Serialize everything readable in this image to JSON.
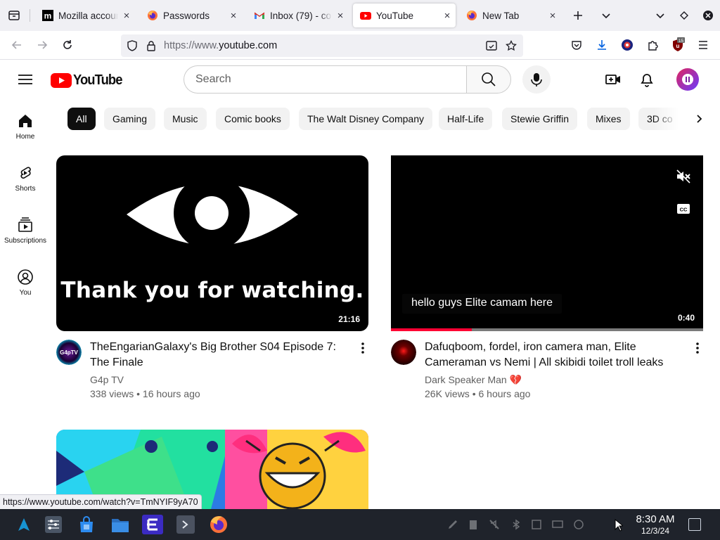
{
  "browser": {
    "tabs": [
      {
        "title": "Mozilla account",
        "favicon": "mozilla-m-icon",
        "active": false
      },
      {
        "title": "Passwords",
        "favicon": "firefox-icon",
        "active": false
      },
      {
        "title": "Inbox (79) - co",
        "favicon": "gmail-icon",
        "active": false
      },
      {
        "title": "YouTube",
        "favicon": "youtube-icon",
        "active": true
      },
      {
        "title": "New Tab",
        "favicon": "firefox-icon",
        "active": false
      }
    ],
    "tab_close_glyph": "×",
    "url_prefix": "https://www.",
    "url_domain": "youtube.com",
    "extension_badge": "15",
    "status_url": "https://www.youtube.com/watch?v=TmNYIF9yA70"
  },
  "youtube": {
    "logo_text": "YouTube",
    "search_placeholder": "Search",
    "guide": [
      {
        "label": "Home",
        "icon": "home-icon"
      },
      {
        "label": "Shorts",
        "icon": "shorts-icon"
      },
      {
        "label": "Subscriptions",
        "icon": "subscriptions-icon"
      },
      {
        "label": "You",
        "icon": "you-icon"
      }
    ],
    "chips": [
      "All",
      "Gaming",
      "Music",
      "Comic books",
      "The Walt Disney Company",
      "Half-Life",
      "Stewie Griffin",
      "Mixes",
      "3D co"
    ],
    "active_chip": "All",
    "videos": [
      {
        "thumb_text": "Thank you for watching.",
        "duration": "21:16",
        "title_line1": "TheEngarianGalaxy's Big Brother S04 Episode 7:",
        "title_line2": "The Finale",
        "channel": "G4p TV",
        "avatar_text": "G4pTV",
        "meta": "338 views • 16 hours ago"
      },
      {
        "subtitle": "hello guys Elite camam here",
        "duration": "0:40",
        "progress": 0.26,
        "title_line1": "Dafuqboom, fordel, iron camera man, Elite",
        "title_line2": "Cameraman vs Nemi | All skibidi toilet troll leaks",
        "channel": "Dark Speaker Man 💔",
        "meta": "26K views • 6 hours ago"
      }
    ]
  },
  "taskbar": {
    "time": "8:30 AM",
    "date": "12/3/24"
  },
  "colors": {
    "yt_red": "#ff0000",
    "chip_active_bg": "#0f0f0f",
    "taskbar_bg": "#1f232b",
    "progress_red": "#ff0033"
  }
}
